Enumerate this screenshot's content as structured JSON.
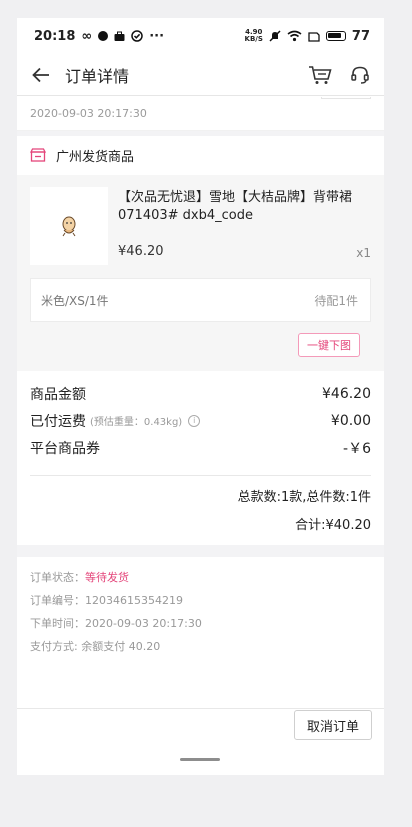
{
  "status_bar": {
    "time": "20:18",
    "infinity_glyph": "∞",
    "more_glyph": "···",
    "net_speed_top": "4.90",
    "net_speed_bottom": "KB/S",
    "battery": "77"
  },
  "app_bar": {
    "title": "订单详情",
    "back_icon": "arrow-left-icon",
    "cart_icon": "cart-icon",
    "service_icon": "headset-icon"
  },
  "order_top": {
    "timestamp": "2020-09-03 20:17:30"
  },
  "shop": {
    "name": "广州发货商品",
    "icon": "shop-icon"
  },
  "product": {
    "title": "【次品无忧退】雪地【大桔品牌】背带裙 071403# dxb4_code",
    "price": "¥46.20",
    "quantity": "x1",
    "sku": "米色/XS/1件",
    "sku_status": "待配1件",
    "action_label": "一键下图"
  },
  "summary": {
    "rows": [
      {
        "label": "商品金额",
        "note": "",
        "value": "¥46.20"
      },
      {
        "label": "已付运费",
        "note": "(预估重量：0.43kg)",
        "value": "¥0.00"
      },
      {
        "label": "平台商品券",
        "note": "",
        "value": "-￥6"
      }
    ],
    "count_text": "总款数:1款,总件数:1件",
    "total_text": "合计:¥40.20"
  },
  "order_info": {
    "status_label": "订单状态：",
    "status_value": "等待发货",
    "number_label": "订单编号：",
    "number_value": "12034615354219",
    "time_label": "下单时间：",
    "time_value": "2020-09-03 20:17:30",
    "payment_label": "支付方式: ",
    "payment_value": "余额支付 40.20"
  },
  "footer": {
    "cancel_label": "取消订单"
  },
  "colors": {
    "accent": "#e4457a",
    "background": "#f0f0f2"
  }
}
